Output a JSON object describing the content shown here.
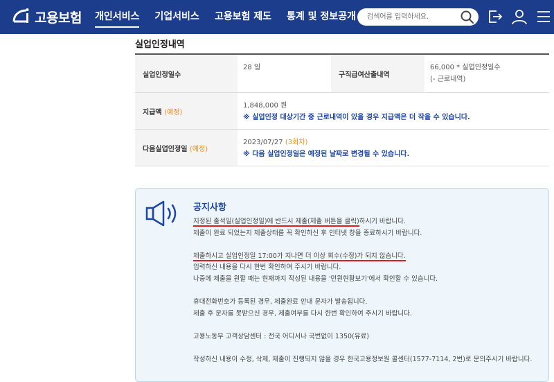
{
  "header": {
    "logo_text": "고용보험",
    "nav": [
      "개인서비스",
      "기업서비스",
      "고용보험 제도",
      "통계 및 정보공개"
    ],
    "search_placeholder": "검색어를 입력하세요.",
    "colors": {
      "header_bg": "#1c3c8c",
      "accent_orange": "#f08a1c",
      "note_blue": "#1d46a8",
      "underline_red": "#e21b23"
    },
    "icons": [
      "search-icon",
      "logout-icon",
      "user-icon",
      "menu-icon"
    ]
  },
  "section": {
    "title": "실업인정내역",
    "days_label": "실업인정일수",
    "days_value": "28 일",
    "calc_label": "구직급여산출내역",
    "calc_value_1": "66,000 * 실업인정일수",
    "calc_value_2": "(- 근로내역)",
    "pay_label": "지급액",
    "pay_label_tag": "(예정)",
    "pay_value": "1,848,000 원",
    "pay_note": "※ 실업인정 대상기간 중 근로내역이 있을 경우 지급액은 더 작을 수 있습니다.",
    "next_label": "다음실업인정일",
    "next_label_tag": "(예정)",
    "next_value": "2023/07/27",
    "next_round": "(3회차)",
    "next_note": "※ 다음 실업인정일은 예정된 날짜로 변경될 수 있습니다."
  },
  "notice": {
    "title": "공지사항",
    "p1_underlined": "지정된 출석일(실업인정일)에 반드시 제출(제출 버튼을 클릭)",
    "p1_rest": "하시기 바랍니다.",
    "p2": "제출이 완료 되었는지 제출상태를 꼭 확인하신 후 인터넷 창을 종료하시기 바랍니다.",
    "p3_underlined": "제출하시고 실업인정일 17:00가 지나면 더 이상 회수(수정)가 되지 않습니다.",
    "p4": "입력하신 내용을 다시 한번 확인하여 주시기 바랍니다.",
    "p5": "나중에 제출을 원할 때는 현재까지 작성된 내용을 '민원현황보기'에서 확인할 수 있습니다.",
    "p6": "휴대전화번호가 등록된 경우, 제출완료 안내 문자가 발송됩니다.",
    "p7": "제출 후 문자를 못받으신 경우, 제출여부를 다시 한번 확인하여 주시기 바랍니다.",
    "p8": "고용노동부 고객상담센터 : 전국 어디서나 국번없이 1350(유료)",
    "p9": "작성하신 내용이 수정, 삭제, 제출이 진행되지 않을 경우 한국고용정보원 콜센터(1577-7114, 2번)로 문의주시기 바랍니다."
  }
}
